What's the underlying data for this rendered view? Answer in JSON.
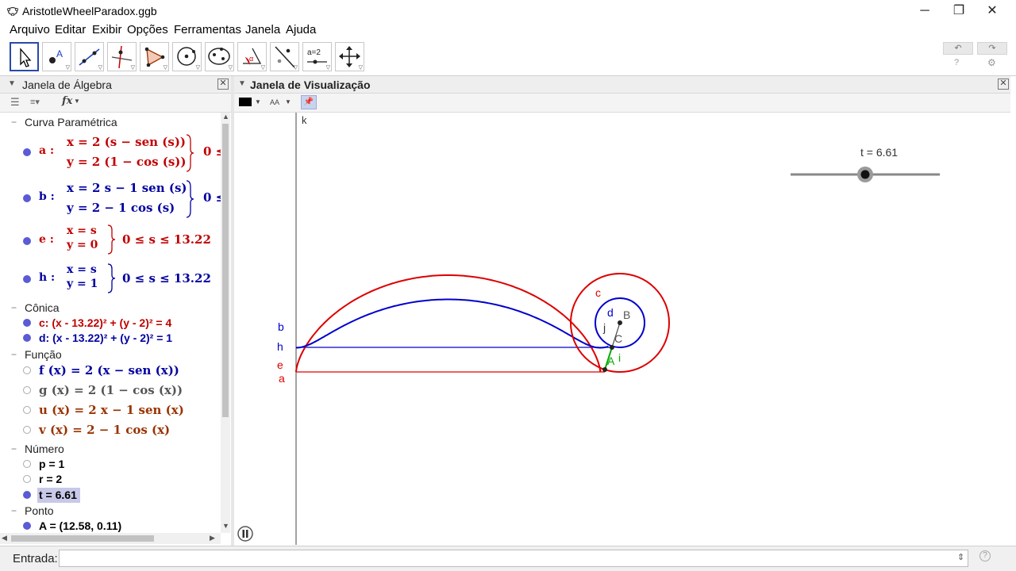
{
  "window": {
    "title": "AristotleWheelParadox.ggb",
    "minimize_glyph": "─",
    "maximize_glyph": "❐",
    "close_glyph": "✕"
  },
  "menu": [
    "Arquivo",
    "Editar",
    "Exibir",
    "Opções",
    "Ferramentas",
    "Janela",
    "Ajuda"
  ],
  "toolbar": {
    "tools": [
      "move-icon",
      "point-icon",
      "line-icon",
      "perpendicular-icon",
      "polygon-icon",
      "circle-icon",
      "conic-icon",
      "angle-icon",
      "reflect-icon",
      "slider-icon",
      "move-graphics-icon"
    ],
    "slider_tool_label": "a=2",
    "undo_glyph": "↶",
    "redo_glyph": "↷",
    "help_glyph": "?",
    "settings_glyph": "⚙"
  },
  "algebra": {
    "title": "Janela de Álgebra",
    "categories": {
      "parametric": "Curva Paramétrica",
      "conic": "Cônica",
      "function": "Função",
      "number": "Número",
      "point": "Ponto"
    },
    "curves": [
      {
        "name": "a :",
        "x": "x = 2  (s − sen (s))",
        "y": "y = 2  (1 − cos (s))",
        "range": "0 ≤"
      },
      {
        "name": "b :",
        "x": "x = 2 s − 1  sen (s)",
        "y": "y = 2 − 1  cos (s)",
        "range": "0 ≤"
      },
      {
        "name": "e :",
        "x": "x = s",
        "y": "y = 0",
        "range": "0 ≤ s ≤ 13.22"
      },
      {
        "name": "h :",
        "x": "x = s",
        "y": "y = 1",
        "range": "0 ≤ s ≤ 13.22"
      }
    ],
    "conics": [
      "c: (x - 13.22)² + (y - 2)² = 4",
      "d: (x - 13.22)² + (y - 2)² = 1"
    ],
    "functions": [
      "f (x)  =  2  (x − sen (x))",
      "g (x)  =  2  (1 − cos (x))",
      "u (x)  =  2 x − 1  sen (x)",
      "v (x)  =  2 − 1  cos (x)"
    ],
    "numbers": [
      "p = 1",
      "r = 2",
      "t = 6.61"
    ],
    "points": [
      "A = (12.58, 0.11)"
    ],
    "fx_label": "fx"
  },
  "graphics": {
    "title": "Janela de Visualização",
    "slider_label": "t = 6.61",
    "slider_value_fraction": 0.5,
    "labels": {
      "k": "k",
      "b": "b",
      "h": "h",
      "e": "e",
      "a": "a",
      "c": "c",
      "d": "d",
      "B": "B",
      "j": "j",
      "C": "C",
      "A": "A",
      "i": "i"
    },
    "colors": {
      "red": "#dd0000",
      "blue": "#0000cc",
      "green": "#009900"
    },
    "font_size_label": "AA"
  },
  "input": {
    "label": "Entrada:",
    "value": "",
    "help_glyph": "?"
  }
}
